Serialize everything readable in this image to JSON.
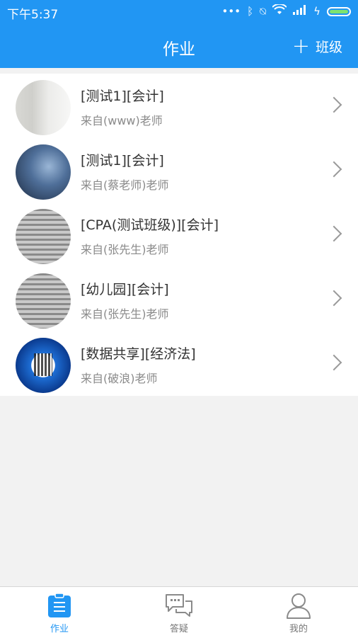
{
  "status_bar": {
    "time": "下午5:37",
    "icons": [
      "more-dots-icon",
      "bluetooth-icon",
      "vibrate-icon",
      "wifi-icon",
      "signal-icon",
      "charging-icon",
      "battery-icon"
    ]
  },
  "header": {
    "title": "作业",
    "add_label": "班级"
  },
  "list": {
    "items": [
      {
        "title": "[测试1][会计]",
        "subtitle": "来自(www)老师"
      },
      {
        "title": "[测试1][会计]",
        "subtitle": "来自(蔡老师)老师"
      },
      {
        "title": "[CPA(测试班级)][会计]",
        "subtitle": "来自(张先生)老师"
      },
      {
        "title": "[幼儿园][会计]",
        "subtitle": "来自(张先生)老师"
      },
      {
        "title": "[数据共享][经济法]",
        "subtitle": "来自(破浪)老师"
      }
    ]
  },
  "tabbar": {
    "tabs": [
      {
        "label": "作业",
        "icon": "homework-icon",
        "active": true
      },
      {
        "label": "答疑",
        "icon": "chat-bubbles-icon",
        "active": false
      },
      {
        "label": "我的",
        "icon": "person-icon",
        "active": false
      }
    ]
  },
  "colors": {
    "primary": "#2196f3",
    "text": "#333333",
    "subtext": "#8a8a8a"
  }
}
